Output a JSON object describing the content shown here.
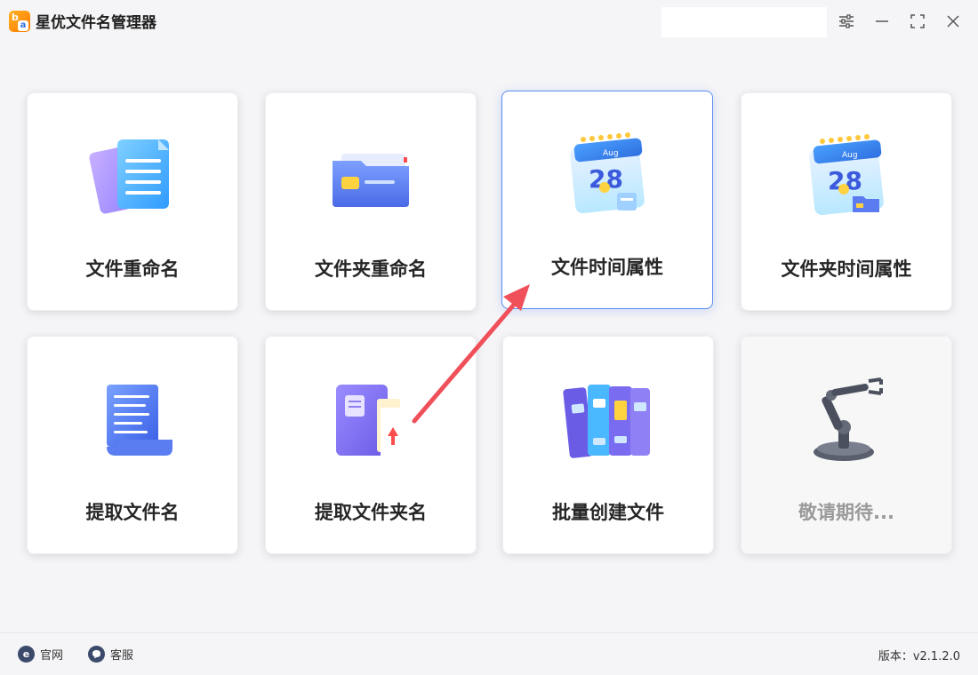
{
  "app": {
    "title": "星优文件名管理器",
    "logo_letters": {
      "b": "b",
      "a": "a"
    }
  },
  "window_controls": {
    "settings_icon": "sliders-icon",
    "minimize_icon": "minimize-icon",
    "maximize_icon": "maximize-icon",
    "close_icon": "close-icon"
  },
  "cards": [
    {
      "label": "文件重命名",
      "icon": "documents-icon"
    },
    {
      "label": "文件夹重命名",
      "icon": "folder-icon"
    },
    {
      "label": "文件时间属性",
      "icon": "calendar-icon",
      "calendar_month": "Aug",
      "calendar_day": "28"
    },
    {
      "label": "文件夹时间属性",
      "icon": "calendar-folder-icon",
      "calendar_month": "Aug",
      "calendar_day": "28"
    },
    {
      "label": "提取文件名",
      "icon": "scroll-icon"
    },
    {
      "label": "提取文件夹名",
      "icon": "book-files-icon"
    },
    {
      "label": "批量创建文件",
      "icon": "binders-icon"
    },
    {
      "label": "敬请期待...",
      "icon": "robot-arm-icon"
    }
  ],
  "footer": {
    "website_label": "官网",
    "website_icon_letter": "e",
    "support_label": "客服",
    "version_text": "版本：v2.1.2.0"
  },
  "colors": {
    "accent": "#5b8df0",
    "arrow": "#f0505a",
    "background": "#f5f5f7"
  }
}
